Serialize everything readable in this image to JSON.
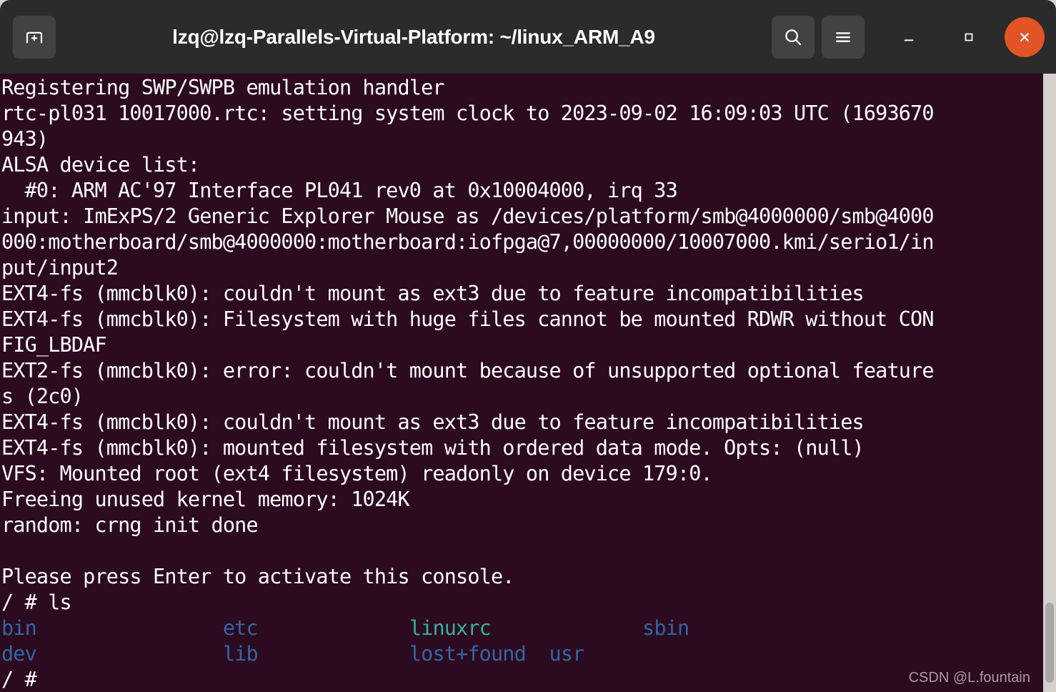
{
  "window": {
    "title": "lzq@lzq-Parallels-Virtual-Platform: ~/linux_ARM_A9",
    "titlebar_bg": "#2b2b2b",
    "terminal_bg": "#2c0a20",
    "close_color": "#e25325"
  },
  "titlebar": {
    "new_tab_label": "New Tab",
    "search_label": "Find",
    "menu_label": "Menu",
    "minimize_label": "Minimize",
    "maximize_label": "Maximize",
    "close_label": "Close"
  },
  "terminal": {
    "prompt": "/ # ",
    "command": "ls",
    "colors": {
      "foreground": "#ffffff",
      "directory": "#3465a4",
      "symlink": "#34b09a"
    },
    "lines": [
      "Registering SWP/SWPB emulation handler",
      "rtc-pl031 10017000.rtc: setting system clock to 2023-09-02 16:09:03 UTC (1693670",
      "943)",
      "ALSA device list:",
      "  #0: ARM AC'97 Interface PL041 rev0 at 0x10004000, irq 33",
      "input: ImExPS/2 Generic Explorer Mouse as /devices/platform/smb@4000000/smb@4000",
      "000:motherboard/smb@4000000:motherboard:iofpga@7,00000000/10007000.kmi/serio1/in",
      "put/input2",
      "EXT4-fs (mmcblk0): couldn't mount as ext3 due to feature incompatibilities",
      "EXT4-fs (mmcblk0): Filesystem with huge files cannot be mounted RDWR without CON",
      "FIG_LBDAF",
      "EXT2-fs (mmcblk0): error: couldn't mount because of unsupported optional feature",
      "s (2c0)",
      "EXT4-fs (mmcblk0): couldn't mount as ext3 due to feature incompatibilities",
      "EXT4-fs (mmcblk0): mounted filesystem with ordered data mode. Opts: (null)",
      "VFS: Mounted root (ext4 filesystem) readonly on device 179:0.",
      "Freeing unused kernel memory: 1024K",
      "random: crng init done",
      "",
      "Please press Enter to activate this console.",
      "/ # ls"
    ],
    "ls_output": [
      [
        {
          "name": "bin",
          "kind": "dir",
          "pad": 16
        },
        {
          "name": "etc",
          "kind": "dir",
          "pad": 13
        },
        {
          "name": "linuxrc",
          "kind": "symlink",
          "pad": 13
        },
        {
          "name": "sbin",
          "kind": "dir",
          "pad": 0
        }
      ],
      [
        {
          "name": "dev",
          "kind": "dir",
          "pad": 16
        },
        {
          "name": "lib",
          "kind": "dir",
          "pad": 13
        },
        {
          "name": "lost+found",
          "kind": "dir",
          "pad": 2
        },
        {
          "name": "usr",
          "kind": "dir",
          "pad": 0
        }
      ]
    ],
    "final_prompt": "/ # "
  },
  "scrollbar": {
    "track_color": "#d4d0cc",
    "thumb_color": "#a8a8a8"
  },
  "watermark": {
    "text": "CSDN @L.fountain"
  }
}
